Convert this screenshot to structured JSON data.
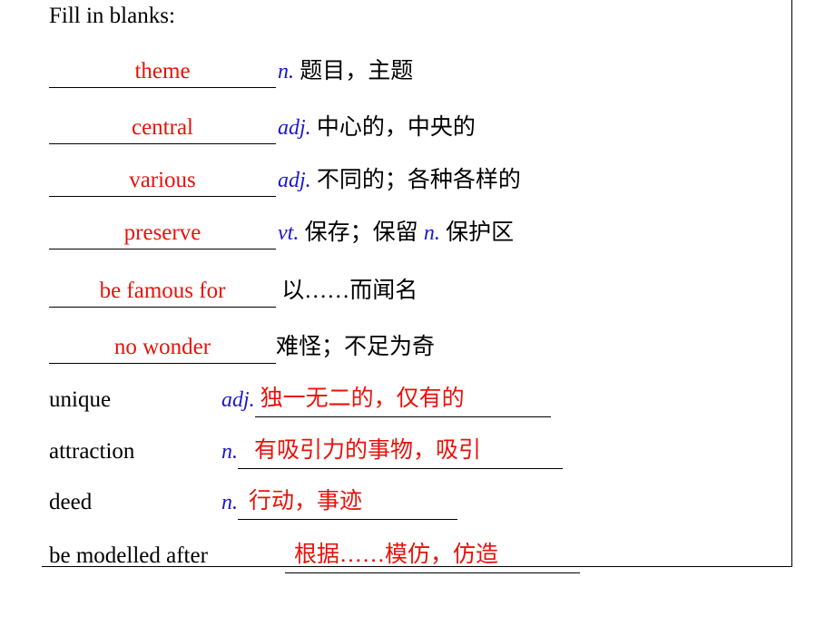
{
  "slide": {
    "title": "Fill in blanks:",
    "rows_blank_first": [
      {
        "answer": "theme",
        "pos": "n.",
        "meaning": "题目，主题"
      },
      {
        "answer": "central",
        "pos": "adj.",
        "meaning": "中心的，中央的"
      },
      {
        "answer": "various",
        "pos": "adj.",
        "meaning": "不同的；各种各样的"
      },
      {
        "answer": "preserve",
        "pos": "vt.",
        "meaning": "保存；保留",
        "pos2": "n.",
        "meaning2": "保护区"
      },
      {
        "answer": "be famous for",
        "pos": "",
        "meaning": "以……而闻名"
      },
      {
        "answer": "no wonder",
        "pos": "",
        "meaning": "难怪；不足为奇"
      }
    ],
    "rows_word_first": [
      {
        "word": "unique",
        "pos": "adj.",
        "answer": "独一无二的，仅有的"
      },
      {
        "word": "attraction",
        "pos": "n.",
        "answer": "有吸引力的事物，吸引"
      },
      {
        "word": "deed",
        "pos": "n.",
        "answer": "行动，事迹"
      },
      {
        "word": "be modelled after",
        "pos": "",
        "answer": "根据……模仿，仿造"
      }
    ],
    "colors": {
      "answer_red": "#e8120a",
      "pos_blue": "#1a18d0",
      "text_black": "#000000"
    }
  }
}
